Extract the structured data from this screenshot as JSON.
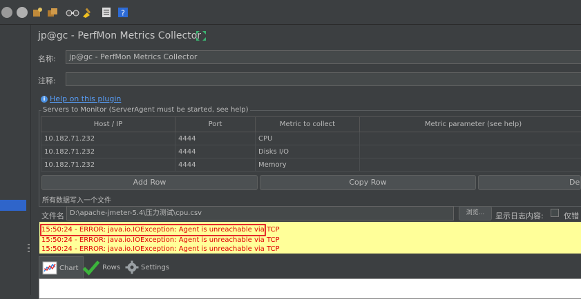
{
  "title": "jp@gc - PerfMon Metrics Collector",
  "name_label": "名称:",
  "name_value": "jp@gc - PerfMon Metrics Collector",
  "comment_label": "注释:",
  "comment_value": "",
  "help_link": "Help on this plugin",
  "servers_group_title": "Servers to Monitor (ServerAgent must be started, see help)",
  "table": {
    "headers": [
      "Host / IP",
      "Port",
      "Metric to collect",
      "Metric parameter (see help)"
    ],
    "rows": [
      [
        "10.182.71.232",
        "4444",
        "CPU",
        ""
      ],
      [
        "10.182.71.232",
        "4444",
        "Disks I/O",
        ""
      ],
      [
        "10.182.71.232",
        "4444",
        "Memory",
        ""
      ]
    ]
  },
  "buttons": {
    "add_row": "Add Row",
    "copy_row": "Copy Row",
    "delete": "Dele"
  },
  "write_all_label": "所有数据写入一个文件",
  "file_label": "文件名",
  "file_value": "D:\\apache-jmeter-5.4\\压力测试\\cpu.csv",
  "browse_button": "浏览...",
  "show_log_label": "显示日志内容:",
  "errors_only_label": "仅错",
  "log_lines": [
    "15:50:24 - ERROR: java.io.IOException: Agent is unreachable via TCP",
    "15:50:24 - ERROR: java.io.IOException: Agent is unreachable via TCP",
    "15:50:24 - ERROR: java.io.IOException: Agent is unreachable via TCP"
  ],
  "tabs": [
    {
      "label": "Chart",
      "icon": "chart-icon",
      "active": true
    },
    {
      "label": "Rows",
      "icon": "checkmark-icon",
      "active": false
    },
    {
      "label": "Settings",
      "icon": "gear-icon",
      "active": false
    }
  ],
  "colors": {
    "background": "#3c3f41",
    "log_background": "#ffff99",
    "log_error": "#e00000",
    "highlight_box": "#e52b2b",
    "link": "#589df6"
  }
}
